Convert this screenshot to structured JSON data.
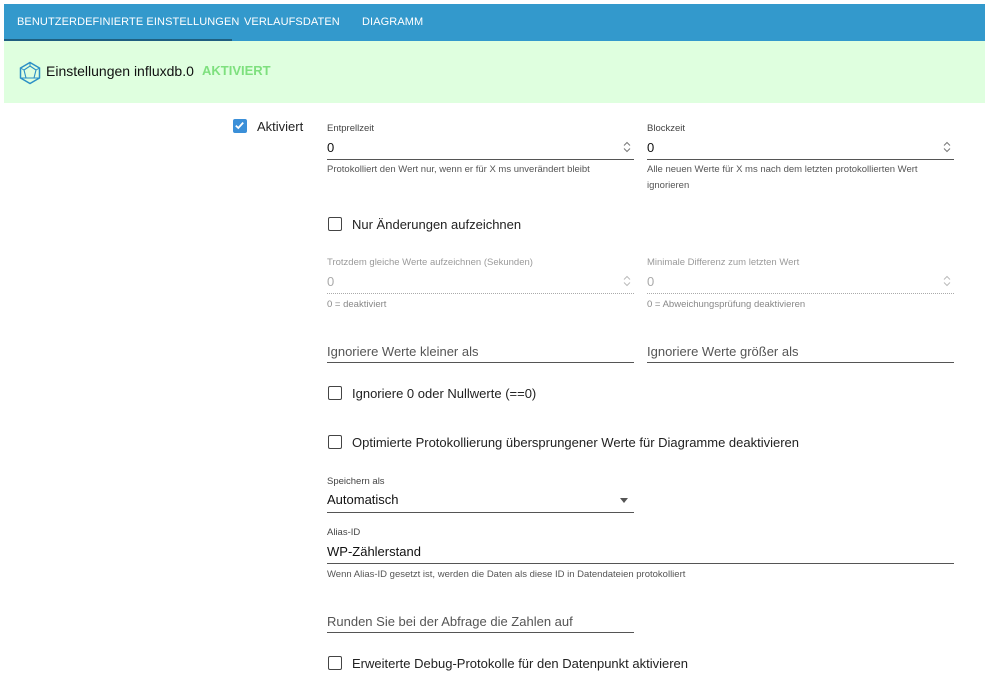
{
  "tabs": [
    {
      "label": "BENUTZERDEFINIERTE EINSTELLUNGEN",
      "active": true
    },
    {
      "label": "VERLAUFSDATEN",
      "active": false
    },
    {
      "label": "DIAGRAMM",
      "active": false
    }
  ],
  "instance": {
    "title": "Einstellungen influxdb.0",
    "status": "AKTIVIERT"
  },
  "enabled": {
    "label": "Aktiviert",
    "checked": true
  },
  "debounce": {
    "label": "Entprellzeit",
    "value": "0",
    "helper": "Protokolliert den Wert nur, wenn er für X ms unverändert bleibt"
  },
  "blocktime": {
    "label": "Blockzeit",
    "value": "0",
    "helper": "Alle neuen Werte für X ms nach dem letzten protokollierten Wert ignorieren"
  },
  "changes_only": {
    "label": "Nur Änderungen aufzeichnen",
    "checked": false
  },
  "same_values": {
    "label": "Trotzdem gleiche Werte aufzeichnen (Sekunden)",
    "value": "0",
    "helper": "0 = deaktiviert"
  },
  "min_diff": {
    "label": "Minimale Differenz zum letzten Wert",
    "value": "0",
    "helper": "0 = Abweichungsprüfung deaktivieren"
  },
  "ignore_below": {
    "placeholder": "Ignoriere Werte kleiner als"
  },
  "ignore_above": {
    "placeholder": "Ignoriere Werte größer als"
  },
  "ignore_zero": {
    "label": "Ignoriere 0 oder Nullwerte (==0)",
    "checked": false
  },
  "optimized": {
    "label": "Optimierte Protokollierung übersprungener Werte für Diagramme deaktivieren",
    "checked": false
  },
  "store_as": {
    "label": "Speichern als",
    "value": "Automatisch"
  },
  "alias": {
    "label": "Alias-ID",
    "value": "WP-Zählerstand",
    "helper": "Wenn Alias-ID gesetzt ist, werden die Daten als diese ID in Datendateien protokolliert"
  },
  "round": {
    "placeholder": "Runden Sie bei der Abfrage die Zahlen auf"
  },
  "debug": {
    "label": "Erweiterte Debug-Protokolle für den Datenpunkt aktivieren",
    "checked": false
  },
  "colors": {
    "tabbar": "#3399cc",
    "instance_bg": "#dfffdf",
    "status": "#7ee07e",
    "checkbox": "#3b8fd8"
  }
}
